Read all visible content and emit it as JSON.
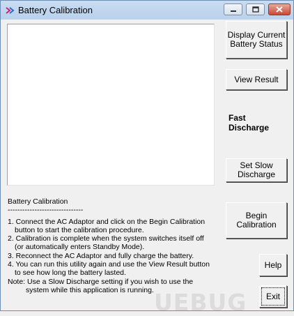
{
  "window": {
    "title": "Battery Calibration"
  },
  "buttons": {
    "display_status": "Display Current\nBattery Status",
    "view_result": "View Result",
    "set_slow_discharge": "Set Slow\nDischarge",
    "begin_calibration": "Begin Calibration",
    "help": "Help",
    "exit": "Exit"
  },
  "labels": {
    "fast_discharge": "Fast\nDischarge"
  },
  "instructions": {
    "heading": "Battery Calibration",
    "separator": "-------------------------------",
    "lines": [
      "1. Connect the AC Adaptor and click on the Begin Calibration",
      "button to start the calibration procedure.",
      "2. Calibration is complete when the system switches itself off",
      "(or automatically enters Standby Mode).",
      "3. Reconnect the AC Adaptor and fully charge the battery.",
      "4. You can run this utility again and use the View Result button",
      "to see how long the battery lasted.",
      "Note: Use a Slow Discharge setting if you wish to use the",
      "system while this application is running."
    ]
  },
  "watermark": {
    "text": "UEBUG"
  },
  "icons": {
    "app": "battery-app-icon",
    "minimize": "minimize-icon",
    "maximize": "maximize-icon",
    "close": "close-icon"
  }
}
